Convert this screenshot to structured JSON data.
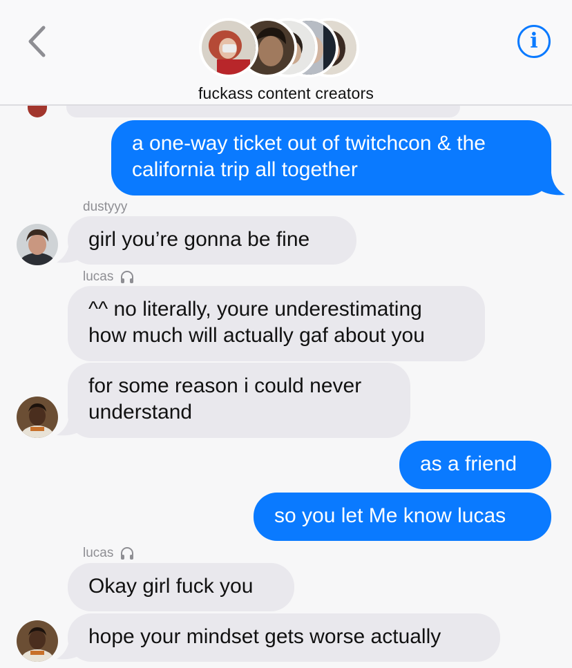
{
  "header": {
    "title": "fuckass content creators",
    "back_icon": "chevron-left-icon",
    "info_icon": "info-icon",
    "info_glyph": "i",
    "accent": "#0a7aff"
  },
  "thread": {
    "messages": [
      {
        "from": "me",
        "lines": [
          "a one-way ticket out of twitchcon & the",
          "california trip all together"
        ]
      },
      {
        "sender": "dustyyy"
      },
      {
        "from": "dustyyy",
        "text": "girl you’re gonna be fine"
      },
      {
        "sender": "lucas"
      },
      {
        "from": "lucas",
        "lines": [
          "^^ no literally, youre underestimating",
          "how much will actually gaf about you"
        ]
      },
      {
        "from": "lucas",
        "lines": [
          "for some reason i could never",
          "understand"
        ]
      },
      {
        "from": "me",
        "text": "as a friend"
      },
      {
        "from": "me",
        "text": "so you let Me know lucas"
      },
      {
        "sender": "lucas"
      },
      {
        "from": "lucas",
        "text": "Okay girl fuck you"
      },
      {
        "from": "lucas",
        "text": "hope your mindset gets worse actually"
      }
    ]
  },
  "colors": {
    "incoming_bubble": "#e9e8ed",
    "outgoing_bubble": "#0a7aff",
    "background": "#f7f7f8",
    "sender_label": "#8e8e93"
  },
  "icons": {
    "focus_icon": "headphones-icon"
  }
}
